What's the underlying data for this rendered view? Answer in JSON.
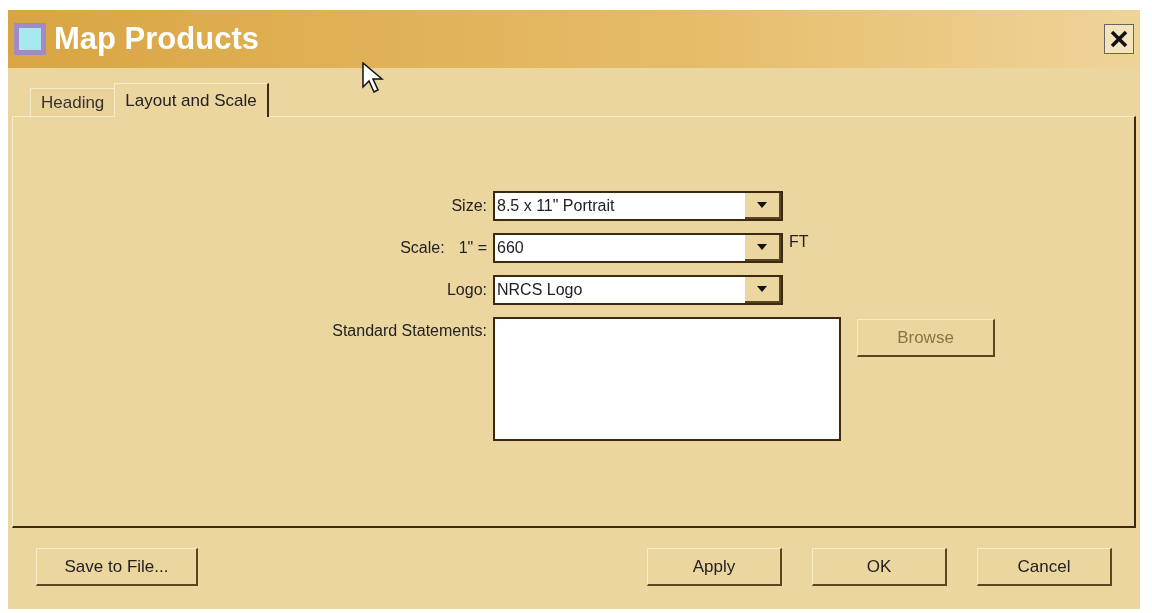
{
  "window": {
    "title": "Map Products"
  },
  "tabs": [
    {
      "label": "Heading",
      "selected": false
    },
    {
      "label": "Layout and Scale",
      "selected": true
    }
  ],
  "fields": [
    {
      "label": "Size:",
      "value": "8.5 x 11\" Portrait"
    },
    {
      "label": "Scale:",
      "prefix": "1\" =",
      "value": "660",
      "suffix": "FT"
    },
    {
      "label": "Logo:",
      "value": "NRCS Logo"
    }
  ],
  "statements": {
    "label": "Standard Statements:",
    "browse": {
      "label": "Browse",
      "disabled": true
    }
  },
  "footer": {
    "left": [
      {
        "label": "Save to File..."
      }
    ],
    "right": [
      {
        "label": "Apply"
      },
      {
        "label": "OK"
      },
      {
        "label": "Cancel"
      }
    ]
  }
}
